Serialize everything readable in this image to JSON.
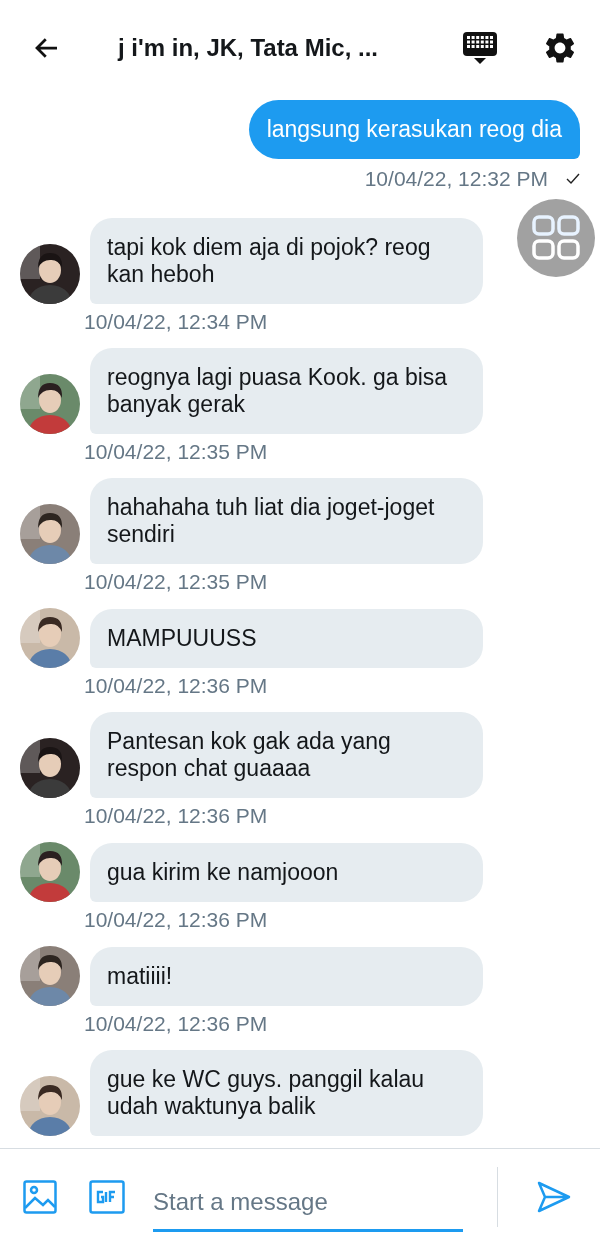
{
  "header": {
    "title": "j i'm in, JK, Tata Mic, ..."
  },
  "messages": [
    {
      "kind": "sent",
      "text": "langsung kerasukan reog dia",
      "time": "10/04/22, 12:32 PM"
    },
    {
      "kind": "received",
      "text": "tapi kok diem aja di pojok? reog kan heboh",
      "time": "10/04/22, 12:34 PM"
    },
    {
      "kind": "received",
      "text": "reognya lagi puasa Kook. ga bisa banyak gerak",
      "time": "10/04/22, 12:35 PM"
    },
    {
      "kind": "received",
      "text": "hahahaha tuh liat dia joget-joget sendiri",
      "time": "10/04/22, 12:35 PM"
    },
    {
      "kind": "received",
      "text": "MAMPUUUSS",
      "time": "10/04/22, 12:36 PM"
    },
    {
      "kind": "received",
      "text": "Pantesan kok gak ada yang respon chat guaaaa",
      "time": "10/04/22, 12:36 PM"
    },
    {
      "kind": "received",
      "text": "gua kirim ke namjooon",
      "time": "10/04/22, 12:36 PM"
    },
    {
      "kind": "received",
      "text": "matiiii!",
      "time": "10/04/22, 12:36 PM"
    },
    {
      "kind": "received",
      "text": "gue ke WC guys. panggil kalau udah waktunya balik"
    }
  ],
  "composer": {
    "placeholder": "Start a message"
  }
}
